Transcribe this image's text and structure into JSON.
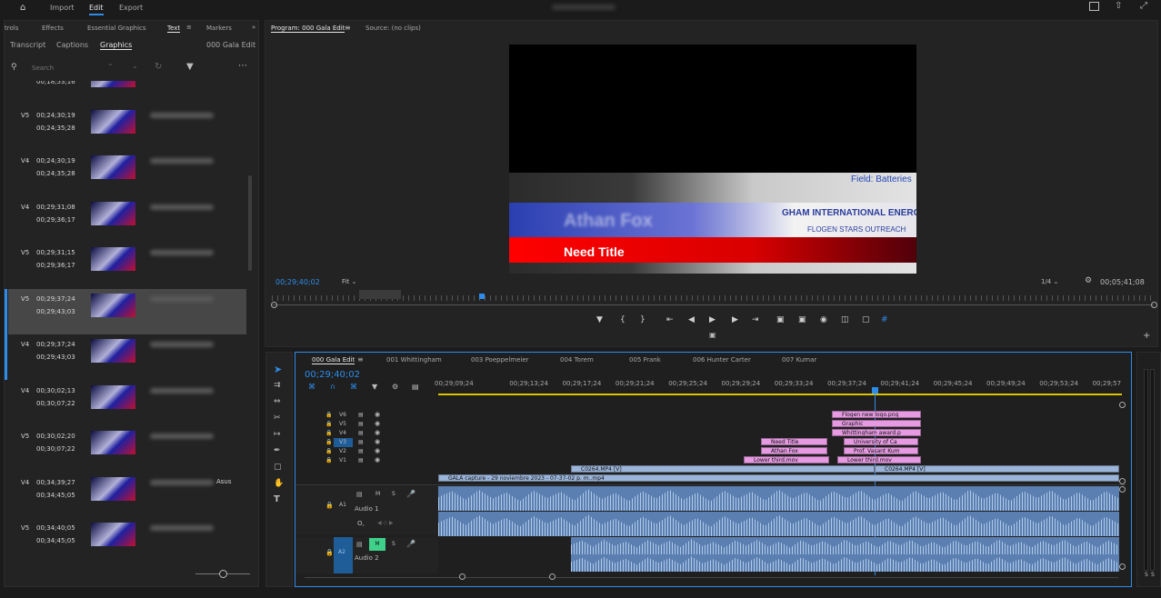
{
  "topbar": {
    "home_icon": "home-icon",
    "nav": [
      "Import",
      "Edit",
      "Export"
    ],
    "active_nav": "Edit",
    "right_icons": [
      "quick-export-icon",
      "share-icon",
      "fullscreen-icon"
    ]
  },
  "left_panel": {
    "tabs": [
      "trols",
      "Effects",
      "Essential Graphics",
      "Text",
      "Markers"
    ],
    "active_tab": "Text",
    "subtabs": [
      "Transcript",
      "Captions",
      "Graphics"
    ],
    "active_subtab": "Graphics",
    "sequence_name": "000 Gala Edit",
    "search_placeholder": "Search",
    "rows": [
      {
        "track": "",
        "in": "",
        "out": "00;18;53;16",
        "selected": false,
        "accent": false
      },
      {
        "track": "V5",
        "in": "00;24;30;19",
        "out": "00;24;35;28",
        "selected": false,
        "accent": false
      },
      {
        "track": "V4",
        "in": "00;24;30;19",
        "out": "00;24;35;28",
        "selected": false,
        "accent": false
      },
      {
        "track": "V4",
        "in": "00;29;31;08",
        "out": "00;29;36;17",
        "selected": false,
        "accent": false
      },
      {
        "track": "V5",
        "in": "00;29;31;15",
        "out": "00;29;36;17",
        "selected": false,
        "accent": false
      },
      {
        "track": "V5",
        "in": "00;29;37;24",
        "out": "00;29;43;03",
        "selected": true,
        "accent": true
      },
      {
        "track": "V4",
        "in": "00;29;37;24",
        "out": "00;29;43;03",
        "selected": false,
        "accent": true
      },
      {
        "track": "V4",
        "in": "00;30;02;13",
        "out": "00;30;07;22",
        "selected": false,
        "accent": false
      },
      {
        "track": "V5",
        "in": "00;30;02;20",
        "out": "00;30;07;22",
        "selected": false,
        "accent": false
      },
      {
        "track": "V4",
        "in": "00;34;39;27",
        "out": "00;34;45;05",
        "selected": false,
        "accent": false,
        "extra": "Asus"
      },
      {
        "track": "V5",
        "in": "00;34;40;05",
        "out": "00;34;45;05",
        "selected": false,
        "accent": false
      }
    ]
  },
  "program": {
    "tab": "Program: 000 Gala Edit",
    "source_tab": "Source: (no clips)",
    "timecode": "00;29;40;02",
    "fit": "Fit",
    "resolution": "1/4",
    "duration": "00;05;41;08",
    "overlay_title": "Need Title",
    "overlay_name": "Athan Fox",
    "field_text": "Field: Batteries",
    "banner_text": "GHAM INTERNATIONAL ENERGY A",
    "banner_sub": "FLOGEN STARS OUTREACH"
  },
  "timeline": {
    "tabs": [
      "000 Gala Edit",
      "001 Whittingham",
      "003 Poeppelmeier",
      "004 Torem",
      "005 Frank",
      "006 Hunter Carter",
      "007 Kumar"
    ],
    "active_tab": "000 Gala Edit",
    "timecode": "00;29;40;02",
    "ruler": [
      "00;29;09;24",
      "00;29;13;24",
      "00;29;17;24",
      "00;29;21;24",
      "00;29;25;24",
      "00;29;29;24",
      "00;29;33;24",
      "00;29;37;24",
      "00;29;41;24",
      "00;29;45;24",
      "00;29;49;24",
      "00;29;53;24",
      "00;29;57"
    ],
    "video_tracks": [
      "V6",
      "V5",
      "V4",
      "V3",
      "V2",
      "V1"
    ],
    "audio_tracks": [
      {
        "id": "A1",
        "name": "Audio 1"
      },
      {
        "id": "A2",
        "name": "Audio 2"
      }
    ],
    "clips": {
      "logo": "Flogen new logo.png",
      "graphic": "Graphic",
      "whittingham": "Whittingham award.p",
      "university": "University of Ca",
      "need_title": "Need Title",
      "prof": "Prof. Vasant Kum",
      "athan": "Athan Fox",
      "lower_third_1": "Lower third.mov",
      "lower_third_2": "Lower third.mov",
      "c0264_a": "C0264.MP4 [V]",
      "c0264_b": "C0264.MP4 [V]",
      "gala": "GALA capture - 29 noviembre 2023 - 07-37-02 p. m..mp4"
    },
    "mute_label": "M",
    "solo_label": "S",
    "v3_label": "V3"
  }
}
